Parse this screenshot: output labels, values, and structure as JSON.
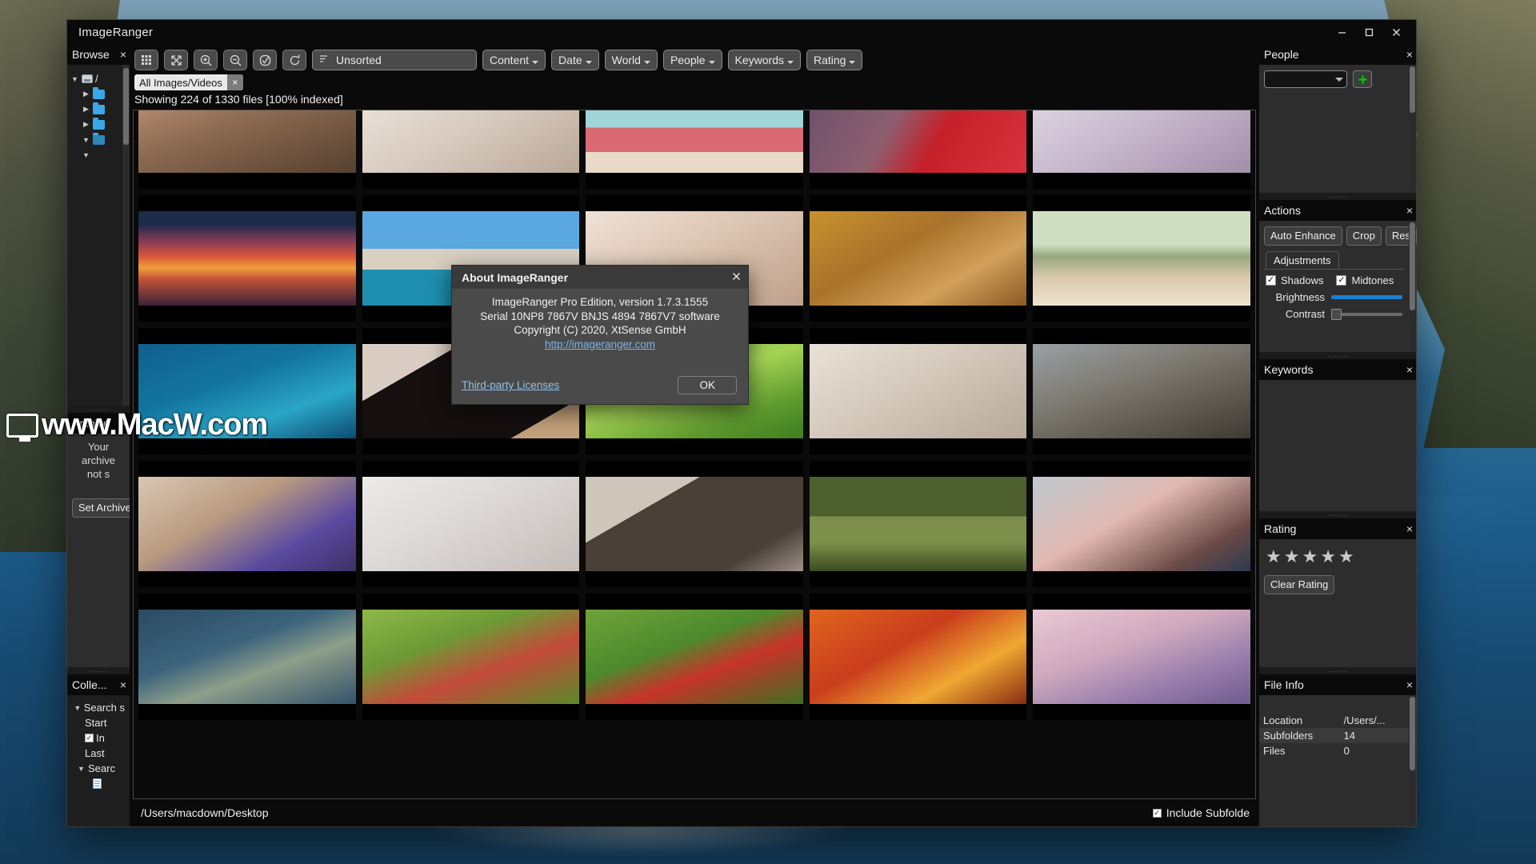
{
  "window": {
    "title": "ImageRanger",
    "controls": {
      "minimize": "minimize-icon",
      "maximize": "maximize-icon",
      "close": "close-icon"
    }
  },
  "toolbar": {
    "buttons": [
      {
        "name": "grid-view-icon",
        "label": "Grid View"
      },
      {
        "name": "fullscreen-icon",
        "label": "Fullscreen"
      },
      {
        "name": "zoom-in-icon",
        "label": "Zoom In"
      },
      {
        "name": "zoom-out-icon",
        "label": "Zoom Out"
      },
      {
        "name": "select-check-icon",
        "label": "Select"
      },
      {
        "name": "refresh-icon",
        "label": "Refresh"
      }
    ],
    "sort": {
      "value": "Unsorted",
      "icon": "sort-icon"
    },
    "filters": [
      {
        "label": "Content"
      },
      {
        "label": "Date"
      },
      {
        "label": "World"
      },
      {
        "label": "People"
      },
      {
        "label": "Keywords"
      },
      {
        "label": "Rating"
      }
    ]
  },
  "filterbar": {
    "chip_label": "All Images/Videos",
    "chip_close": "×"
  },
  "status": {
    "text": "Showing 224 of 1330 files [100% indexed]"
  },
  "pathbar": {
    "path": "/Users/macdown/Desktop",
    "include_subfolders_label": "Include Subfolde",
    "include_subfolders_checked": true
  },
  "left_dock": {
    "browse": {
      "title": "Browse",
      "close": "×",
      "tree": [
        {
          "indent": 0,
          "twisty": "▼",
          "icon": "disk",
          "label": "/"
        },
        {
          "indent": 1,
          "twisty": "▶",
          "icon": "folder",
          "label": ""
        },
        {
          "indent": 1,
          "twisty": "▶",
          "icon": "folder",
          "label": ""
        },
        {
          "indent": 1,
          "twisty": "▶",
          "icon": "folder",
          "label": ""
        },
        {
          "indent": 1,
          "twisty": "▼",
          "icon": "folder-selected",
          "label": ""
        },
        {
          "indent": 1,
          "twisty": "▼",
          "icon": "none",
          "label": ""
        }
      ]
    },
    "archive": {
      "title": "Archive",
      "close": "×",
      "message_line1": "Your archive",
      "message_line2": "not s",
      "button": "Set Archive"
    },
    "collections": {
      "title": "Colle...",
      "close": "×",
      "rows": [
        {
          "indent": 0,
          "twisty": "▼",
          "type": "text",
          "label": "Search s"
        },
        {
          "indent": 1,
          "twisty": "",
          "type": "text",
          "label": "Start"
        },
        {
          "indent": 1,
          "twisty": "",
          "type": "check",
          "checked": true,
          "label": "In"
        },
        {
          "indent": 1,
          "twisty": "",
          "type": "text",
          "label": "Last"
        },
        {
          "indent": 0,
          "twisty": "▼",
          "type": "text",
          "label": "Searc"
        },
        {
          "indent": 2,
          "twisty": "",
          "type": "doc",
          "label": ""
        }
      ]
    }
  },
  "right_dock": {
    "people": {
      "title": "People",
      "close": "×",
      "combo_value": "",
      "add_button": "+"
    },
    "actions": {
      "title": "Actions",
      "close": "×",
      "buttons": [
        "Auto Enhance",
        "Crop",
        "Res"
      ],
      "tab": "Adjustments",
      "checkboxes": [
        {
          "label": "Shadows",
          "checked": true
        },
        {
          "label": "Midtones",
          "checked": true
        }
      ],
      "sliders": [
        {
          "label": "Brightness",
          "value": 100,
          "filled": true
        },
        {
          "label": "Contrast",
          "value": 0,
          "filled": false
        }
      ]
    },
    "keywords": {
      "title": "Keywords",
      "close": "×"
    },
    "rating": {
      "title": "Rating",
      "close": "×",
      "stars": 5,
      "stars_filled": 0,
      "clear_button": "Clear Rating"
    },
    "file_info": {
      "title": "File Info",
      "close": "×",
      "rows": [
        {
          "key": "Location",
          "value": "/Users/..."
        },
        {
          "key": "Subfolders",
          "value": "14"
        },
        {
          "key": "Files",
          "value": "0"
        }
      ]
    }
  },
  "about_dialog": {
    "title": "About ImageRanger",
    "close": "×",
    "line1": "ImageRanger Pro Edition, version 1.7.3.1555",
    "line2": "Serial 10NP8 7867V BNJS 4894 7867V7 software",
    "line3": "Copyright (C) 2020, XtSense GmbH",
    "link": "http://imageranger.com",
    "third_party": "Third-party Licenses",
    "ok": "OK"
  },
  "watermark": {
    "text": "www.MacW.com"
  },
  "thumbnails": [
    {
      "name": "woman-flowers",
      "css": "linear-gradient(160deg,#c89a7e,#8d6b52 45%,#55402f)"
    },
    {
      "name": "white-fabric",
      "css": "linear-gradient(150deg,#efe7e0,#d8cbc0 50%,#b9a898)"
    },
    {
      "name": "cupcake",
      "css": "linear-gradient(180deg,#9fd4d8 0 52%,#f0e4d6 52%,#d96a74 52% 78%,#e8d9c8 78%)"
    },
    {
      "name": "red-dress",
      "css": "linear-gradient(120deg,#6a4f6b,#8d5f6f 40%,#c5202a 60%,#d8333c)"
    },
    {
      "name": "woman-purple",
      "css": "linear-gradient(150deg,#e3dce6,#c8b8cd 50%,#a18ea8)"
    },
    {
      "name": "sunset-silhouette",
      "css": "linear-gradient(180deg,#1d2a4a 0 14%,#7b3a57 30%,#d9553a 48%,#f0a03c 60%,#c25136 72%,#3a2438 100%)"
    },
    {
      "name": "harbour-church",
      "css": "linear-gradient(180deg,#5ba8e0 0 40%,#d9d0c2 40% 62%,#1e8fae 62%)"
    },
    {
      "name": "ballet-shoes",
      "css": "linear-gradient(150deg,#efe2d7,#dcc6b4 45%,#bfa18c)"
    },
    {
      "name": "woman-swimsuit",
      "css": "linear-gradient(150deg,#c8922f,#a9722b 40%,#d1a05a 70%,#8a5a24)"
    },
    {
      "name": "violin-field",
      "css": "linear-gradient(180deg,#cfe0c2 0 35%,#97a77e 48%,#d9c9ab 70%,#efe4cf)"
    },
    {
      "name": "tropical-fish",
      "css": "linear-gradient(160deg,#0f5f8f,#13759f 40%,#2aa6c6 70%,#0c4a72)"
    },
    {
      "name": "woman-black-dress",
      "css": "linear-gradient(150deg,#d9ccc2 0 26%,#15100f 26% 82%,#c2a07a 82%)"
    },
    {
      "name": "bluebird-blossom",
      "css": "linear-gradient(160deg,#7fbf3f,#a5d455 45%,#5f9b2e 75%,#3f7d20)"
    },
    {
      "name": "brides-white",
      "css": "linear-gradient(150deg,#e9e2d8,#d4c9bc 45%,#b7a899)"
    },
    {
      "name": "kitten",
      "css": "linear-gradient(160deg,#9aa0a4,#7d7a72 40%,#59554c 75%,#3e3a33)"
    },
    {
      "name": "sleeping-child",
      "css": "linear-gradient(150deg,#d9c7b3,#b99a80 40%,#5a4aa0 72%,#3b3166)"
    },
    {
      "name": "white-gown",
      "css": "linear-gradient(150deg,#eceaea,#dcd8d6 45%,#c3bdb9)"
    },
    {
      "name": "man-vest",
      "css": "linear-gradient(150deg,#cfc6bb 0 30%,#4b4038 30% 78%,#9e9287)"
    },
    {
      "name": "crane-bird",
      "css": "linear-gradient(180deg,#4e5f2e 0 42%,#7d8f4a 42% 70%,#3d4a22)"
    },
    {
      "name": "woman-pink-coat",
      "css": "linear-gradient(150deg,#bfc9cf,#e2b9b2 42%,#6b4a46 78%,#2b3a52)"
    },
    {
      "name": "umbrella-rain",
      "css": "linear-gradient(160deg,#2a4a63,#3d647d 40%,#8e9e8a 62%,#33526b)"
    },
    {
      "name": "parrot-flight",
      "css": "linear-gradient(160deg,#8fb84a,#6d9a35 35%,#c44a3a 62%,#5a8a2a)"
    },
    {
      "name": "train-forest",
      "css": "linear-gradient(160deg,#6fa33a,#4d8a2c 40%,#c8332a 62%,#3e6f22)"
    },
    {
      "name": "autumn-leaves",
      "css": "linear-gradient(150deg,#e0651f,#c93d1c 40%,#f0a832 70%,#8a2b12)"
    },
    {
      "name": "lavender-field",
      "css": "linear-gradient(160deg,#e9c9d4,#cfa9bd 40%,#9a7fae 70%,#6f5b8f)"
    }
  ]
}
